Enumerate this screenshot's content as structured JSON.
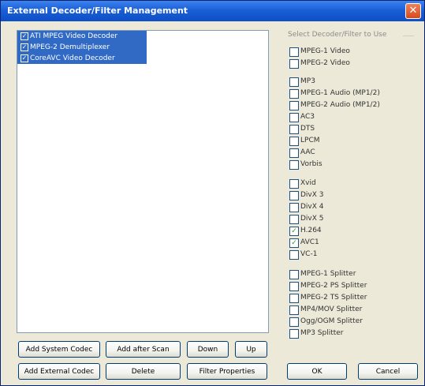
{
  "window": {
    "title": "External Decoder/Filter Management",
    "close_glyph": "✕"
  },
  "list": {
    "items": [
      {
        "label": "ATI MPEG Video Decoder",
        "checked": true
      },
      {
        "label": "MPEG-2 Demultiplexer",
        "checked": true
      },
      {
        "label": "CoreAVC Video Decoder",
        "checked": true
      }
    ]
  },
  "group": {
    "title": "Select Decoder/Filter to Use",
    "options": [
      {
        "label": "MPEG-1 Video",
        "checked": false
      },
      {
        "label": "MPEG-2 Video",
        "checked": false
      },
      {
        "label": "MP3",
        "checked": false
      },
      {
        "label": "MPEG-1 Audio (MP1/2)",
        "checked": false
      },
      {
        "label": "MPEG-2 Audio (MP1/2)",
        "checked": false
      },
      {
        "label": "AC3",
        "checked": false
      },
      {
        "label": "DTS",
        "checked": false
      },
      {
        "label": "LPCM",
        "checked": false
      },
      {
        "label": "AAC",
        "checked": false
      },
      {
        "label": "Vorbis",
        "checked": false
      },
      {
        "label": "Xvid",
        "checked": false
      },
      {
        "label": "DivX 3",
        "checked": false
      },
      {
        "label": "DivX 4",
        "checked": false
      },
      {
        "label": "DivX 5",
        "checked": false
      },
      {
        "label": "H.264",
        "checked": true
      },
      {
        "label": "AVC1",
        "checked": true
      },
      {
        "label": "VC-1",
        "checked": false
      },
      {
        "label": "MPEG-1 Splitter",
        "checked": false
      },
      {
        "label": "MPEG-2 PS Splitter",
        "checked": false
      },
      {
        "label": "MPEG-2 TS Splitter",
        "checked": false
      },
      {
        "label": "MP4/MOV Splitter",
        "checked": false
      },
      {
        "label": "Ogg/OGM Splitter",
        "checked": false
      },
      {
        "label": "MP3 Splitter",
        "checked": false
      }
    ]
  },
  "buttons": {
    "add_system_codec": "Add System Codec",
    "add_after_scan": "Add after Scan",
    "down": "Down",
    "up": "Up",
    "add_external_codec": "Add External Codec",
    "delete": "Delete",
    "filter_properties": "Filter Properties",
    "ok": "OK",
    "cancel": "Cancel"
  },
  "check_glyph": "✓"
}
